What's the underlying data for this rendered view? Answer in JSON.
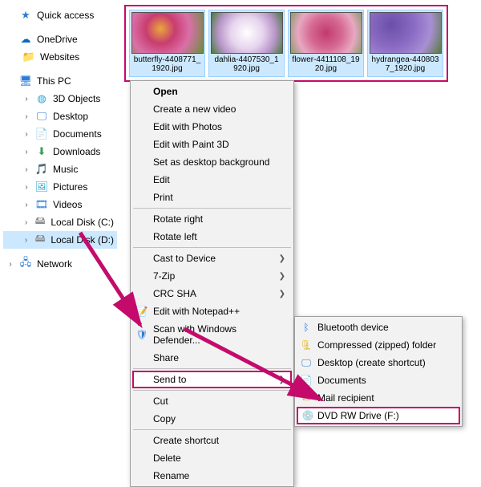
{
  "sidebar": {
    "quick_access": "Quick access",
    "onedrive": "OneDrive",
    "websites": "Websites",
    "this_pc": "This PC",
    "objects3d": "3D Objects",
    "desktop": "Desktop",
    "documents": "Documents",
    "downloads": "Downloads",
    "music": "Music",
    "pictures": "Pictures",
    "videos": "Videos",
    "local_c": "Local Disk (C:)",
    "local_d": "Local Disk (D:)",
    "network": "Network"
  },
  "thumbs": [
    "butterfly-4408771_1920.jpg",
    "dahlia-4407530_1920.jpg",
    "flower-4411108_1920.jpg",
    "hydrangea-440803 7_1920.jpg"
  ],
  "menu": {
    "open": "Open",
    "create_video": "Create a new video",
    "edit_photos": "Edit with Photos",
    "edit_paint3d": "Edit with Paint 3D",
    "set_bg": "Set as desktop background",
    "edit": "Edit",
    "print": "Print",
    "rotate_right": "Rotate right",
    "rotate_left": "Rotate left",
    "cast": "Cast to Device",
    "zip": "7-Zip",
    "crc": "CRC SHA",
    "notepad": "Edit with Notepad++",
    "defender": "Scan with Windows Defender...",
    "share": "Share",
    "send_to": "Send to",
    "cut": "Cut",
    "copy": "Copy",
    "shortcut": "Create shortcut",
    "delete": "Delete",
    "rename": "Rename"
  },
  "submenu": {
    "bluetooth": "Bluetooth device",
    "compressed": "Compressed (zipped) folder",
    "desktop_sc": "Desktop (create shortcut)",
    "documents": "Documents",
    "mail": "Mail recipient",
    "dvd": "DVD RW Drive (F:)"
  }
}
